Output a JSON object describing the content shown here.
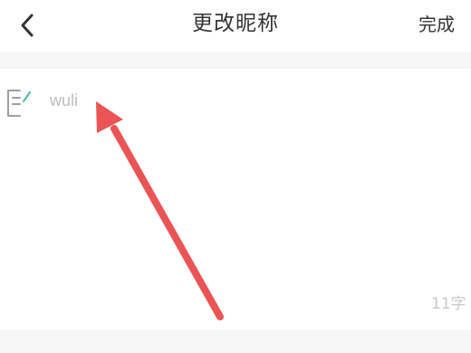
{
  "header": {
    "back_icon": "chevron-left-icon",
    "title": "更改昵称",
    "done_label": "完成"
  },
  "nickname": {
    "edit_icon": "edit-note-icon",
    "value": "wuli",
    "counter": "11字"
  },
  "annotation": {
    "arrow_color": "#ea5455"
  }
}
